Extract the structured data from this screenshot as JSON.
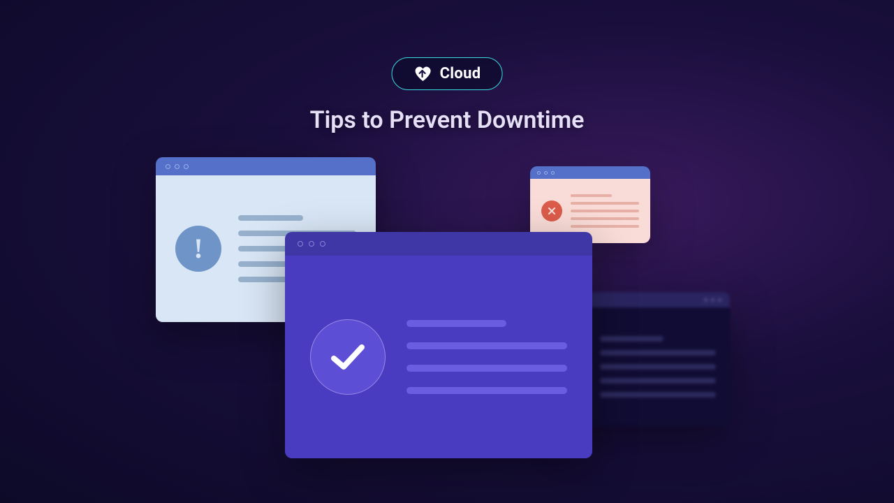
{
  "brand": {
    "name": "Cloud"
  },
  "headline": "Tips to Prevent Downtime",
  "icons": {
    "exclaim": "!",
    "check": "check",
    "cross": "cross",
    "block": "block"
  }
}
